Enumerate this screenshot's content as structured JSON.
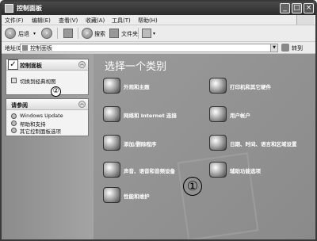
{
  "window": {
    "title": "控制面板"
  },
  "menu": [
    "文件(F)",
    "编辑(E)",
    "查看(V)",
    "收藏(A)",
    "工具(T)",
    "帮助(H)"
  ],
  "toolbar": {
    "back_label": "后退",
    "search_label": "搜索",
    "folders_label": "文件夹"
  },
  "address": {
    "label": "地址(D)",
    "value": "控制面板",
    "go_label": "转到"
  },
  "sidebar": {
    "panel1": {
      "title": "控制面板",
      "link": "切换到经典视图"
    },
    "panel2": {
      "title": "请参阅",
      "links": [
        "Windows Update",
        "帮助和支持",
        "其它控制面板选项"
      ]
    }
  },
  "main": {
    "heading": "选择一个类别",
    "categories": [
      "外观和主题",
      "打印机和其它硬件",
      "网络和 Internet 连接",
      "用户帐户",
      "添加/删除程序",
      "日期、时间、语言和区域设置",
      "声音、语音和音频设备",
      "辅助功能选项",
      "性能和维护"
    ]
  },
  "callouts": {
    "one": "①",
    "two": "②"
  },
  "icons": {
    "app": "control-panel-icon",
    "back": "back-arrow-icon",
    "forward": "forward-arrow-icon",
    "up": "up-folder-icon",
    "search": "search-icon",
    "folders": "folders-icon",
    "views": "views-icon"
  }
}
